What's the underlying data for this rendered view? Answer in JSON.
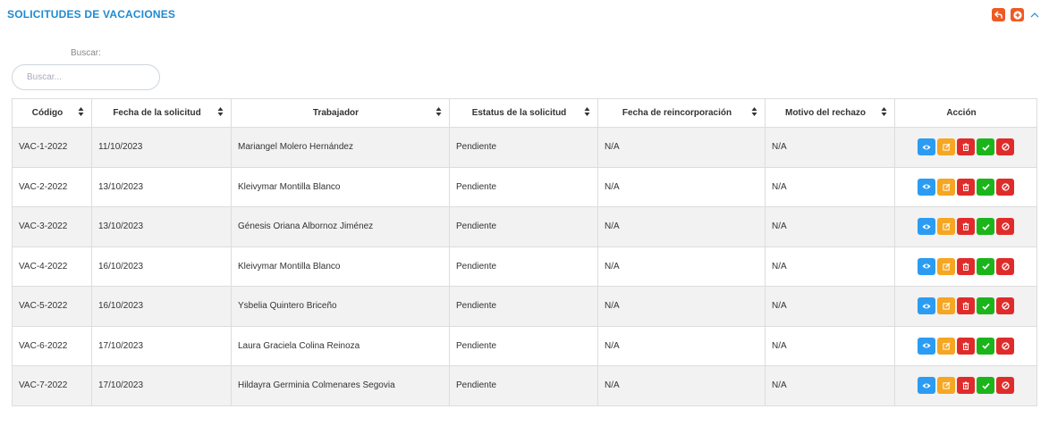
{
  "panel": {
    "title": "SOLICITUDES DE VACACIONES",
    "tools": [
      {
        "name": "undo-icon",
        "color": "#ee5a24"
      },
      {
        "name": "add-circle-icon",
        "color": "#ee5a24"
      },
      {
        "name": "chevron-up-icon",
        "color": "#1f8ad2"
      }
    ]
  },
  "search": {
    "label": "Buscar:",
    "placeholder": "Buscar...",
    "value": ""
  },
  "table": {
    "columns": [
      "Código",
      "Fecha de la solicitud",
      "Trabajador",
      "Estatus de la solicitud",
      "Fecha de reincorporación",
      "Motivo del rechazo",
      "Acción"
    ],
    "sortable": [
      true,
      true,
      true,
      true,
      true,
      true,
      false
    ],
    "rows": [
      {
        "codigo": "VAC-1-2022",
        "fecha": "11/10/2023",
        "trabajador": "Mariangel Molero Hernández",
        "estatus": "Pendiente",
        "reincorporacion": "N/A",
        "motivo": "N/A"
      },
      {
        "codigo": "VAC-2-2022",
        "fecha": "13/10/2023",
        "trabajador": "Kleivymar Montilla Blanco",
        "estatus": "Pendiente",
        "reincorporacion": "N/A",
        "motivo": "N/A"
      },
      {
        "codigo": "VAC-3-2022",
        "fecha": "13/10/2023",
        "trabajador": "Génesis Oriana Albornoz Jiménez",
        "estatus": "Pendiente",
        "reincorporacion": "N/A",
        "motivo": "N/A"
      },
      {
        "codigo": "VAC-4-2022",
        "fecha": "16/10/2023",
        "trabajador": "Kleivymar Montilla Blanco",
        "estatus": "Pendiente",
        "reincorporacion": "N/A",
        "motivo": "N/A"
      },
      {
        "codigo": "VAC-5-2022",
        "fecha": "16/10/2023",
        "trabajador": "Ysbelia Quintero Briceño",
        "estatus": "Pendiente",
        "reincorporacion": "N/A",
        "motivo": "N/A"
      },
      {
        "codigo": "VAC-6-2022",
        "fecha": "17/10/2023",
        "trabajador": "Laura Graciela Colina Reinoza",
        "estatus": "Pendiente",
        "reincorporacion": "N/A",
        "motivo": "N/A"
      },
      {
        "codigo": "VAC-7-2022",
        "fecha": "17/10/2023",
        "trabajador": "Hildayra Germinia Colmenares Segovia",
        "estatus": "Pendiente",
        "reincorporacion": "N/A",
        "motivo": "N/A"
      }
    ],
    "row_actions": [
      {
        "key": "view",
        "icon": "eye-icon",
        "color": "#2b9cf2"
      },
      {
        "key": "edit",
        "icon": "edit-icon",
        "color": "#f5a623"
      },
      {
        "key": "del",
        "icon": "trash-icon",
        "color": "#e02b2b"
      },
      {
        "key": "ok",
        "icon": "check-icon",
        "color": "#1bb51b"
      },
      {
        "key": "rej",
        "icon": "ban-icon",
        "color": "#e02b2b"
      }
    ]
  }
}
